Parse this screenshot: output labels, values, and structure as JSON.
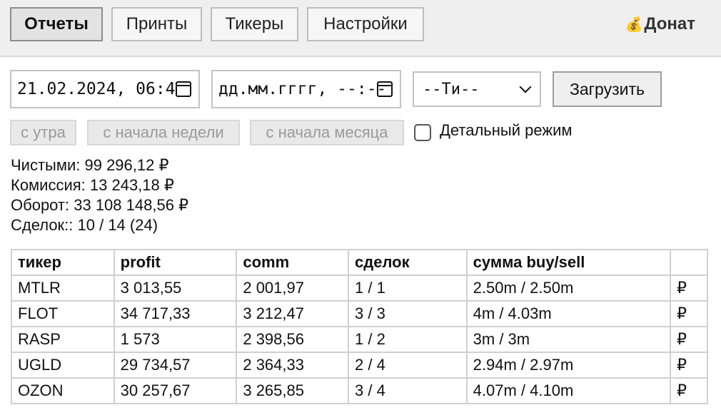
{
  "nav": {
    "tabs": [
      {
        "label": "Отчеты",
        "active": true
      },
      {
        "label": "Принты",
        "active": false
      },
      {
        "label": "Тикеры",
        "active": false
      },
      {
        "label": "Настройки",
        "active": false
      }
    ],
    "donate_icon": "💰",
    "donate_label": "Донат"
  },
  "filters": {
    "date_from": "21.02.2024, 06:4",
    "date_to_placeholder": "дд.мм.гггг, --:--",
    "type_select": "--Ти--",
    "load_button": "Загрузить",
    "quick_ranges": [
      "с утра",
      "с начала недели",
      "с начала месяца"
    ],
    "detailed_mode_label": "Детальный режим",
    "detailed_mode_checked": false
  },
  "summary": {
    "net": "Чистыми: 99 296,12 ₽",
    "commission": "Комиссия: 13 243,18 ₽",
    "turnover": "Оборот: 33 108 148,56 ₽",
    "deals": "Сделок:: 10 / 14 (24)"
  },
  "table": {
    "headers": [
      "тикер",
      "profit",
      "comm",
      "сделок",
      "сумма buy/sell",
      ""
    ],
    "rows": [
      [
        "MTLR",
        "3 013,55",
        "2 001,97",
        "1 / 1",
        "2.50m / 2.50m",
        "₽"
      ],
      [
        "FLOT",
        "34 717,33",
        "3 212,47",
        "3 / 3",
        "4m / 4.03m",
        "₽"
      ],
      [
        "RASP",
        "1 573",
        "2 398,56",
        "1 / 2",
        "3m / 3m",
        "₽"
      ],
      [
        "UGLD",
        "29 734,57",
        "2 364,33",
        "2 / 4",
        "2.94m / 2.97m",
        "₽"
      ],
      [
        "OZON",
        "30 257,67",
        "3 265,85",
        "3 / 4",
        "4.07m / 4.10m",
        "₽"
      ]
    ]
  }
}
